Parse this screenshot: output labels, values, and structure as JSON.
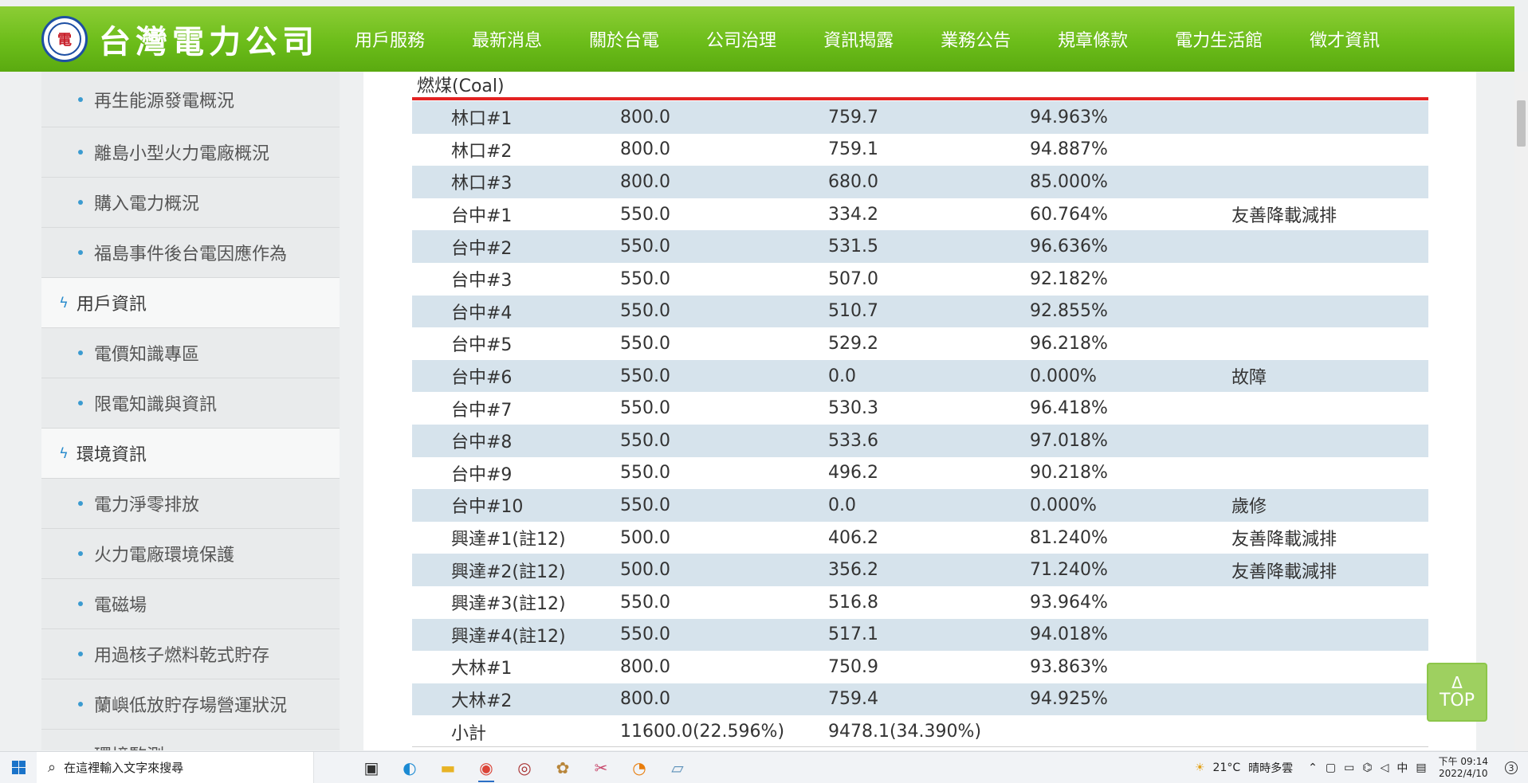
{
  "header": {
    "logo_text": "台灣電力公司",
    "logo_mark": "電",
    "nav": [
      "用戶服務",
      "最新消息",
      "關於台電",
      "公司治理",
      "資訊揭露",
      "業務公告",
      "規章條款",
      "電力生活館",
      "徵才資訊"
    ],
    "active_nav": "資訊揭露"
  },
  "sidebar": {
    "items": [
      {
        "type": "sub",
        "label": "再生能源發電概況"
      },
      {
        "type": "sub",
        "label": "離島小型火力電廠概況"
      },
      {
        "type": "sub",
        "label": "購入電力概況"
      },
      {
        "type": "sub",
        "label": "福島事件後台電因應作為"
      },
      {
        "type": "cat",
        "label": "用戶資訊"
      },
      {
        "type": "sub",
        "label": "電價知識專區"
      },
      {
        "type": "sub",
        "label": "限電知識與資訊"
      },
      {
        "type": "cat",
        "label": "環境資訊"
      },
      {
        "type": "sub",
        "label": "電力淨零排放"
      },
      {
        "type": "sub",
        "label": "火力電廠環境保護"
      },
      {
        "type": "sub",
        "label": "電磁場"
      },
      {
        "type": "sub",
        "label": "用過核子燃料乾式貯存"
      },
      {
        "type": "sub",
        "label": "蘭嶼低放貯存場營運狀況"
      },
      {
        "type": "sub",
        "label": "環境監測"
      }
    ]
  },
  "section": {
    "title": "燃煤(Coal)"
  },
  "table": {
    "rows": [
      [
        "林口#1",
        "800.0",
        "759.7",
        "94.963%",
        ""
      ],
      [
        "林口#2",
        "800.0",
        "759.1",
        "94.887%",
        ""
      ],
      [
        "林口#3",
        "800.0",
        "680.0",
        "85.000%",
        ""
      ],
      [
        "台中#1",
        "550.0",
        "334.2",
        "60.764%",
        "友善降載減排"
      ],
      [
        "台中#2",
        "550.0",
        "531.5",
        "96.636%",
        ""
      ],
      [
        "台中#3",
        "550.0",
        "507.0",
        "92.182%",
        ""
      ],
      [
        "台中#4",
        "550.0",
        "510.7",
        "92.855%",
        ""
      ],
      [
        "台中#5",
        "550.0",
        "529.2",
        "96.218%",
        ""
      ],
      [
        "台中#6",
        "550.0",
        "0.0",
        "0.000%",
        "故障"
      ],
      [
        "台中#7",
        "550.0",
        "530.3",
        "96.418%",
        ""
      ],
      [
        "台中#8",
        "550.0",
        "533.6",
        "97.018%",
        ""
      ],
      [
        "台中#9",
        "550.0",
        "496.2",
        "90.218%",
        ""
      ],
      [
        "台中#10",
        "550.0",
        "0.0",
        "0.000%",
        "歲修"
      ],
      [
        "興達#1(註12)",
        "500.0",
        "406.2",
        "81.240%",
        "友善降載減排"
      ],
      [
        "興達#2(註12)",
        "500.0",
        "356.2",
        "71.240%",
        "友善降載減排"
      ],
      [
        "興達#3(註12)",
        "550.0",
        "516.8",
        "93.964%",
        ""
      ],
      [
        "興達#4(註12)",
        "550.0",
        "517.1",
        "94.018%",
        ""
      ],
      [
        "大林#1",
        "800.0",
        "750.9",
        "93.863%",
        ""
      ],
      [
        "大林#2",
        "800.0",
        "759.4",
        "94.925%",
        ""
      ],
      [
        "小計",
        "11600.0(22.596%)",
        "9478.1(34.390%)",
        "",
        ""
      ]
    ]
  },
  "top_button": {
    "arrow": "Δ",
    "label": "TOP"
  },
  "taskbar": {
    "search_placeholder": "在這裡輸入文字來搜尋",
    "weather_temp": "21°C",
    "weather_text": "晴時多雲",
    "ime": "中",
    "time": "下午 09:14",
    "date": "2022/4/10",
    "notification_count": "3"
  }
}
